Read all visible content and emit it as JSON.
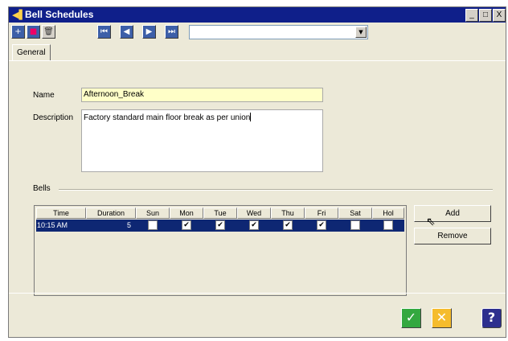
{
  "window": {
    "title": "Bell Schedules",
    "icon": "bell-icon",
    "buttons": [
      "_",
      "□",
      "X"
    ]
  },
  "toolbar": {
    "buttons": [
      {
        "name": "add",
        "icon": "plus-icon",
        "glyph": "+"
      },
      {
        "name": "save",
        "icon": "save-icon",
        "glyph": "■"
      },
      {
        "name": "delete",
        "icon": "trash-icon",
        "glyph": "🗑"
      },
      {
        "name": "first",
        "icon": "first-record-icon",
        "glyph": "⏮"
      },
      {
        "name": "previous",
        "icon": "previous-record-icon",
        "glyph": "◀"
      },
      {
        "name": "next",
        "icon": "next-record-icon",
        "glyph": "▶"
      },
      {
        "name": "last",
        "icon": "last-record-icon",
        "glyph": "⏭"
      }
    ],
    "record_select": {
      "value": "",
      "arrow": "▼"
    }
  },
  "tabs": [
    {
      "label": "General",
      "active": true
    }
  ],
  "form": {
    "name_label": "Name",
    "name_value": "Afternoon_Break",
    "description_label": "Description",
    "description_value": "Factory standard main floor break as per union",
    "bells_label": "Bells"
  },
  "bells_table": {
    "columns": [
      "Time",
      "Duration",
      "Sun",
      "Mon",
      "Tue",
      "Wed",
      "Thu",
      "Fri",
      "Sat",
      "Hol"
    ],
    "rows": [
      {
        "time": "10:15 AM",
        "duration": "5",
        "days": [
          false,
          true,
          true,
          true,
          true,
          true,
          false,
          false
        ],
        "selected": true
      }
    ]
  },
  "bell_buttons": {
    "add": "Add",
    "remove": "Remove"
  },
  "footer_buttons": [
    {
      "name": "ok",
      "icon": "checkmark-icon",
      "glyph": "✓",
      "color": "#34a840"
    },
    {
      "name": "cancel",
      "icon": "cancel-x-icon",
      "glyph": "✕",
      "color": "#f5bc2d"
    },
    {
      "name": "help",
      "icon": "question-icon",
      "glyph": "?",
      "color": "#2d2f8e"
    }
  ],
  "colors": {
    "title_bar": "#0f1f8a",
    "selected_row": "#0e2773",
    "name_field_bg": "#ffffc8",
    "window_bg": "#ece9d8"
  }
}
